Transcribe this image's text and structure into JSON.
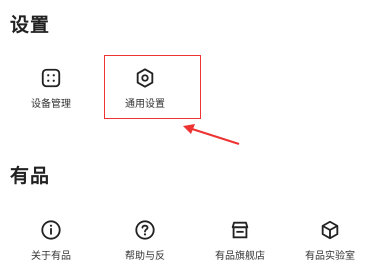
{
  "sections": {
    "settings": {
      "title": "设置",
      "items": [
        {
          "label": "设备管理",
          "icon": "device-management-icon"
        },
        {
          "label": "通用设置",
          "icon": "general-settings-icon"
        }
      ]
    },
    "youpin": {
      "title": "有品",
      "items": [
        {
          "label": "关于有品",
          "icon": "info-icon"
        },
        {
          "label": "帮助与反",
          "icon": "help-icon"
        },
        {
          "label": "有品旗舰店",
          "icon": "store-icon"
        },
        {
          "label": "有品实验室",
          "icon": "cube-icon"
        }
      ]
    }
  },
  "annotation": {
    "highlight_color": "#e33333"
  }
}
